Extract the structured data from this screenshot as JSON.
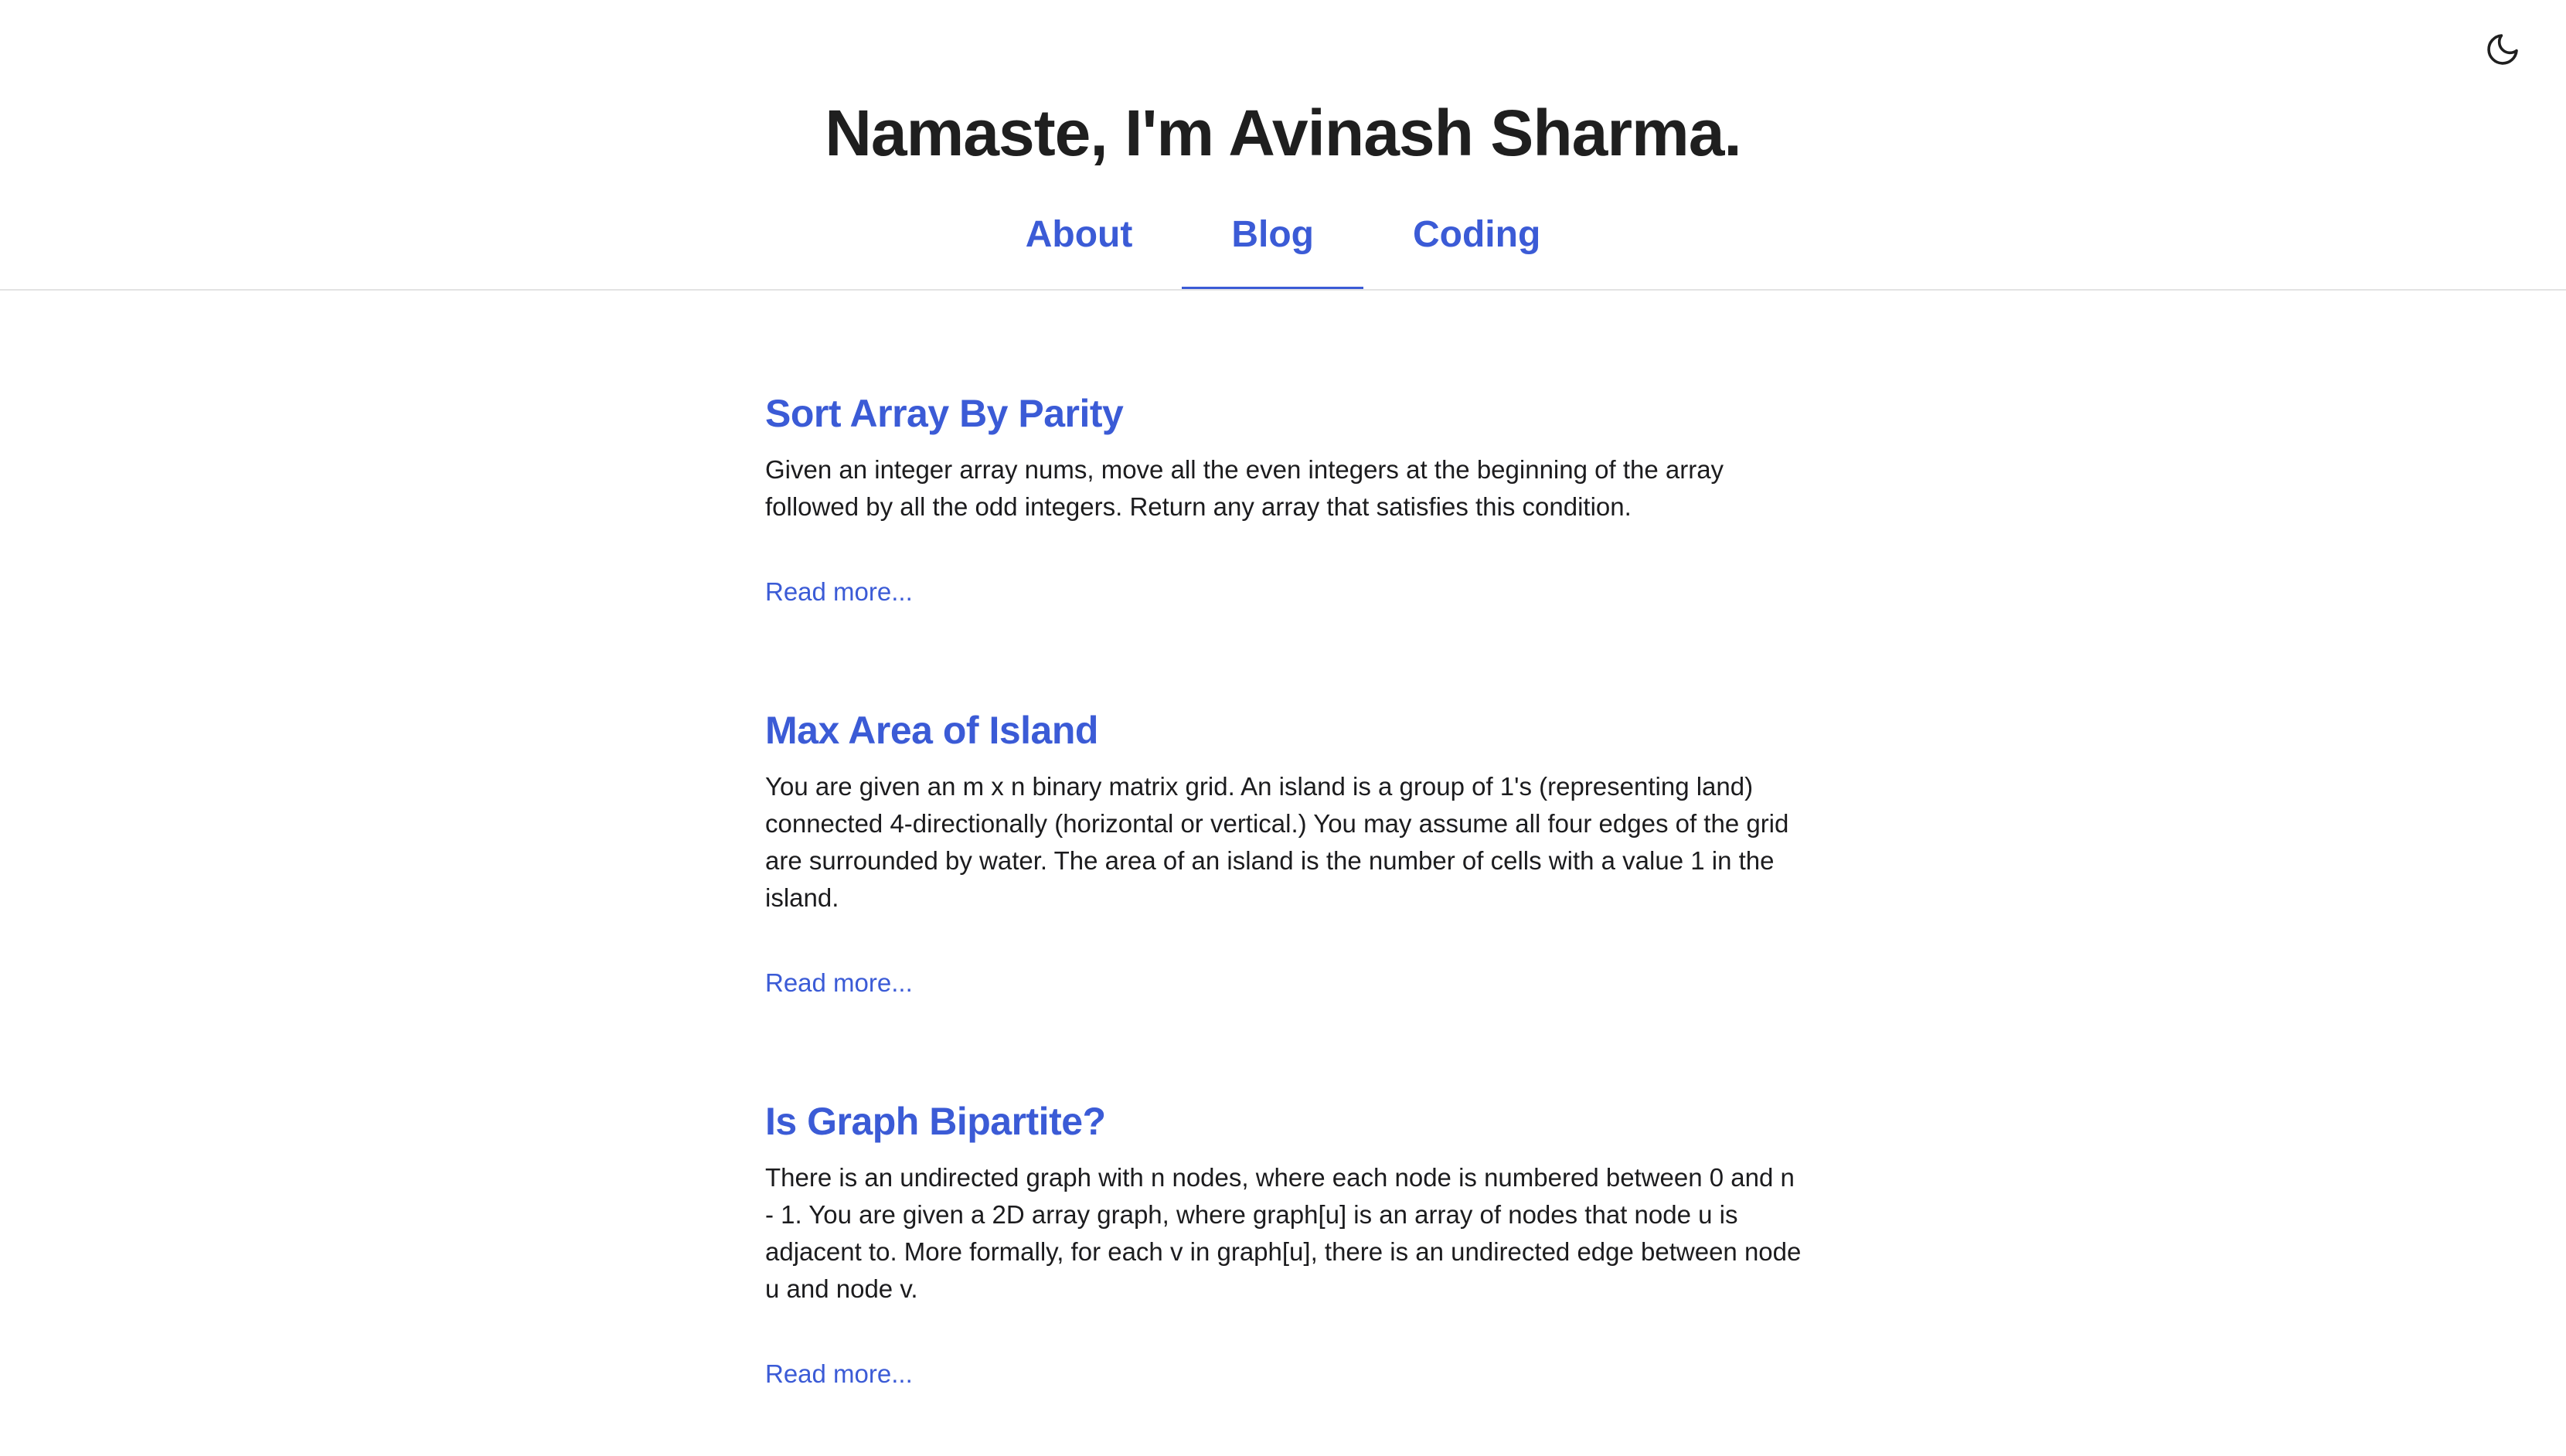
{
  "header": {
    "title": "Namaste, I'm Avinash Sharma.",
    "theme_toggle_icon": "moon-icon"
  },
  "nav": {
    "items": [
      {
        "label": "About",
        "active": false
      },
      {
        "label": "Blog",
        "active": true
      },
      {
        "label": "Coding",
        "active": false
      }
    ]
  },
  "posts": [
    {
      "title": "Sort Array By Parity",
      "excerpt": "Given an integer array nums, move all the even integers at the beginning of the array followed by all the odd integers. Return any array that satisfies this condition.",
      "read_more": "Read more..."
    },
    {
      "title": "Max Area of Island",
      "excerpt": "You are given an m x n binary matrix grid. An island is a group of 1's (representing land) connected 4-directionally (horizontal or vertical.) You may assume all four edges of the grid are surrounded by water. The area of an island is the number of cells with a value 1 in the island.",
      "read_more": "Read more..."
    },
    {
      "title": "Is Graph Bipartite?",
      "excerpt": "There is an undirected graph with n nodes, where each node is numbered between 0 and n - 1. You are given a 2D array graph, where graph[u] is an array of nodes that node u is adjacent to. More formally, for each v in graph[u], there is an undirected edge between node u and node v.",
      "read_more": "Read more..."
    }
  ],
  "colors": {
    "accent": "#3b5bd6",
    "text": "#1c1c1e",
    "divider": "#e3e3e3"
  }
}
